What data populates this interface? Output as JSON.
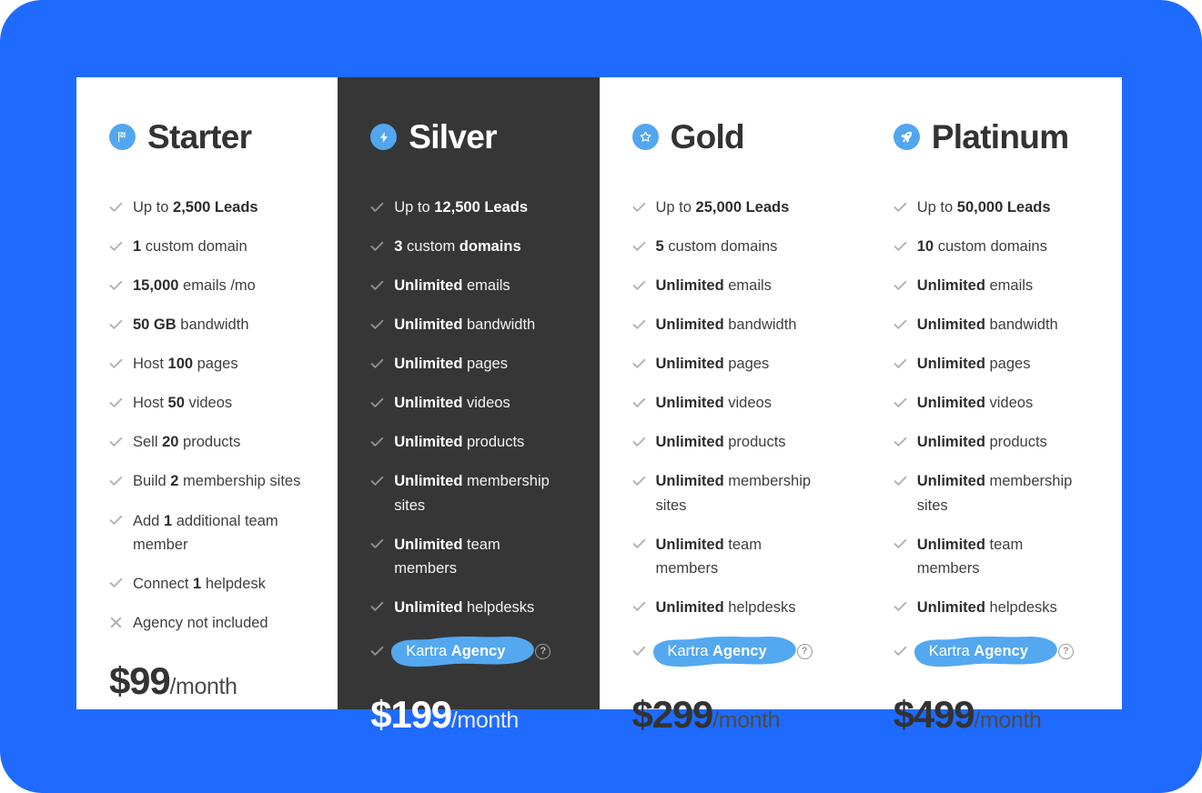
{
  "theme": {
    "backdrop_color": "#1F6BFF",
    "panel_color": "#FFFFFF",
    "featured_color": "#363636",
    "icon_badge_color": "#52A6EF",
    "highlight_color": "#54A8F0"
  },
  "plans": [
    {
      "name": "Starter",
      "icon": "flag-icon",
      "featured": false,
      "price_amount": "$99",
      "price_period": "/month",
      "features": [
        {
          "mark": "check-icon",
          "parts": [
            {
              "t": "Up to ",
              "b": false
            },
            {
              "t": "2,500 Leads",
              "b": true
            }
          ]
        },
        {
          "mark": "check-icon",
          "parts": [
            {
              "t": "1",
              "b": true
            },
            {
              "t": " custom domain",
              "b": false
            }
          ]
        },
        {
          "mark": "check-icon",
          "parts": [
            {
              "t": "15,000",
              "b": true
            },
            {
              "t": " emails /mo",
              "b": false
            }
          ]
        },
        {
          "mark": "check-icon",
          "parts": [
            {
              "t": "50 GB",
              "b": true
            },
            {
              "t": " bandwidth",
              "b": false
            }
          ]
        },
        {
          "mark": "check-icon",
          "parts": [
            {
              "t": "Host ",
              "b": false
            },
            {
              "t": "100",
              "b": true
            },
            {
              "t": " pages",
              "b": false
            }
          ]
        },
        {
          "mark": "check-icon",
          "parts": [
            {
              "t": "Host ",
              "b": false
            },
            {
              "t": "50",
              "b": true
            },
            {
              "t": " videos",
              "b": false
            }
          ]
        },
        {
          "mark": "check-icon",
          "parts": [
            {
              "t": "Sell ",
              "b": false
            },
            {
              "t": "20",
              "b": true
            },
            {
              "t": " products",
              "b": false
            }
          ]
        },
        {
          "mark": "check-icon",
          "parts": [
            {
              "t": "Build ",
              "b": false
            },
            {
              "t": "2",
              "b": true
            },
            {
              "t": " membership sites",
              "b": false
            }
          ]
        },
        {
          "mark": "check-icon",
          "parts": [
            {
              "t": "Add ",
              "b": false
            },
            {
              "t": "1",
              "b": true
            },
            {
              "t": " additional team member",
              "b": false
            }
          ]
        },
        {
          "mark": "check-icon",
          "parts": [
            {
              "t": "Connect ",
              "b": false
            },
            {
              "t": "1",
              "b": true
            },
            {
              "t": " helpdesk",
              "b": false
            }
          ]
        },
        {
          "mark": "cross-icon",
          "parts": [
            {
              "t": "Agency not included",
              "b": false
            }
          ]
        }
      ]
    },
    {
      "name": "Silver",
      "icon": "lightning-bolt-icon",
      "featured": true,
      "price_amount": "$199",
      "price_period": "/month",
      "features": [
        {
          "mark": "check-icon",
          "parts": [
            {
              "t": "Up to ",
              "b": false
            },
            {
              "t": "12,500 Leads",
              "b": true
            }
          ]
        },
        {
          "mark": "check-icon",
          "parts": [
            {
              "t": "3",
              "b": true
            },
            {
              "t": " custom ",
              "b": false
            },
            {
              "t": "domains",
              "b": true
            }
          ]
        },
        {
          "mark": "check-icon",
          "parts": [
            {
              "t": "Unlimited",
              "b": true
            },
            {
              "t": " emails",
              "b": false
            }
          ]
        },
        {
          "mark": "check-icon",
          "parts": [
            {
              "t": "Unlimited",
              "b": true
            },
            {
              "t": " bandwidth",
              "b": false
            }
          ]
        },
        {
          "mark": "check-icon",
          "parts": [
            {
              "t": "Unlimited",
              "b": true
            },
            {
              "t": " pages",
              "b": false
            }
          ]
        },
        {
          "mark": "check-icon",
          "parts": [
            {
              "t": "Unlimited",
              "b": true
            },
            {
              "t": " videos",
              "b": false
            }
          ]
        },
        {
          "mark": "check-icon",
          "parts": [
            {
              "t": "Unlimited",
              "b": true
            },
            {
              "t": " products",
              "b": false
            }
          ]
        },
        {
          "mark": "check-icon",
          "parts": [
            {
              "t": "Unlimited",
              "b": true
            },
            {
              "t": " membership sites",
              "b": false
            }
          ]
        },
        {
          "mark": "check-icon",
          "parts": [
            {
              "t": "Unlimited",
              "b": true
            },
            {
              "t": " team members",
              "b": false
            }
          ]
        },
        {
          "mark": "check-icon",
          "parts": [
            {
              "t": "Unlimited",
              "b": true
            },
            {
              "t": " helpdesks",
              "b": false
            }
          ]
        },
        {
          "mark": "check-icon",
          "highlight": true,
          "help": "?",
          "parts": [
            {
              "t": "Kartra ",
              "b": false
            },
            {
              "t": "Agency",
              "b": true
            }
          ]
        }
      ]
    },
    {
      "name": "Gold",
      "icon": "star-icon",
      "featured": false,
      "price_amount": "$299",
      "price_period": "/month",
      "features": [
        {
          "mark": "check-icon",
          "parts": [
            {
              "t": "Up to ",
              "b": false
            },
            {
              "t": "25,000 Leads",
              "b": true
            }
          ]
        },
        {
          "mark": "check-icon",
          "parts": [
            {
              "t": "5",
              "b": true
            },
            {
              "t": " custom domains",
              "b": false
            }
          ]
        },
        {
          "mark": "check-icon",
          "parts": [
            {
              "t": "Unlimited",
              "b": true
            },
            {
              "t": " emails",
              "b": false
            }
          ]
        },
        {
          "mark": "check-icon",
          "parts": [
            {
              "t": "Unlimited",
              "b": true
            },
            {
              "t": " bandwidth",
              "b": false
            }
          ]
        },
        {
          "mark": "check-icon",
          "parts": [
            {
              "t": "Unlimited",
              "b": true
            },
            {
              "t": " pages",
              "b": false
            }
          ]
        },
        {
          "mark": "check-icon",
          "parts": [
            {
              "t": "Unlimited",
              "b": true
            },
            {
              "t": " videos",
              "b": false
            }
          ]
        },
        {
          "mark": "check-icon",
          "parts": [
            {
              "t": "Unlimited",
              "b": true
            },
            {
              "t": " products",
              "b": false
            }
          ]
        },
        {
          "mark": "check-icon",
          "parts": [
            {
              "t": "Unlimited",
              "b": true
            },
            {
              "t": " membership sites",
              "b": false
            }
          ]
        },
        {
          "mark": "check-icon",
          "parts": [
            {
              "t": "Unlimited",
              "b": true
            },
            {
              "t": " team members",
              "b": false
            }
          ]
        },
        {
          "mark": "check-icon",
          "parts": [
            {
              "t": "Unlimited",
              "b": true
            },
            {
              "t": " helpdesks",
              "b": false
            }
          ]
        },
        {
          "mark": "check-icon",
          "highlight": true,
          "help": "?",
          "parts": [
            {
              "t": "Kartra ",
              "b": false
            },
            {
              "t": "Agency",
              "b": true
            }
          ]
        }
      ]
    },
    {
      "name": "Platinum",
      "icon": "rocket-icon",
      "featured": false,
      "price_amount": "$499",
      "price_period": "/month",
      "features": [
        {
          "mark": "check-icon",
          "parts": [
            {
              "t": "Up to ",
              "b": false
            },
            {
              "t": "50,000 Leads",
              "b": true
            }
          ]
        },
        {
          "mark": "check-icon",
          "parts": [
            {
              "t": "10",
              "b": true
            },
            {
              "t": " custom domains",
              "b": false
            }
          ]
        },
        {
          "mark": "check-icon",
          "parts": [
            {
              "t": "Unlimited",
              "b": true
            },
            {
              "t": " emails",
              "b": false
            }
          ]
        },
        {
          "mark": "check-icon",
          "parts": [
            {
              "t": "Unlimited",
              "b": true
            },
            {
              "t": " bandwidth",
              "b": false
            }
          ]
        },
        {
          "mark": "check-icon",
          "parts": [
            {
              "t": "Unlimited",
              "b": true
            },
            {
              "t": " pages",
              "b": false
            }
          ]
        },
        {
          "mark": "check-icon",
          "parts": [
            {
              "t": "Unlimited",
              "b": true
            },
            {
              "t": " videos",
              "b": false
            }
          ]
        },
        {
          "mark": "check-icon",
          "parts": [
            {
              "t": "Unlimited",
              "b": true
            },
            {
              "t": " products",
              "b": false
            }
          ]
        },
        {
          "mark": "check-icon",
          "parts": [
            {
              "t": "Unlimited",
              "b": true
            },
            {
              "t": " membership sites",
              "b": false
            }
          ]
        },
        {
          "mark": "check-icon",
          "parts": [
            {
              "t": "Unlimited",
              "b": true
            },
            {
              "t": " team members",
              "b": false
            }
          ]
        },
        {
          "mark": "check-icon",
          "parts": [
            {
              "t": "Unlimited",
              "b": true
            },
            {
              "t": " helpdesks",
              "b": false
            }
          ]
        },
        {
          "mark": "check-icon",
          "highlight": true,
          "help": "?",
          "parts": [
            {
              "t": "Kartra ",
              "b": false
            },
            {
              "t": "Agency",
              "b": true
            }
          ]
        }
      ]
    }
  ]
}
